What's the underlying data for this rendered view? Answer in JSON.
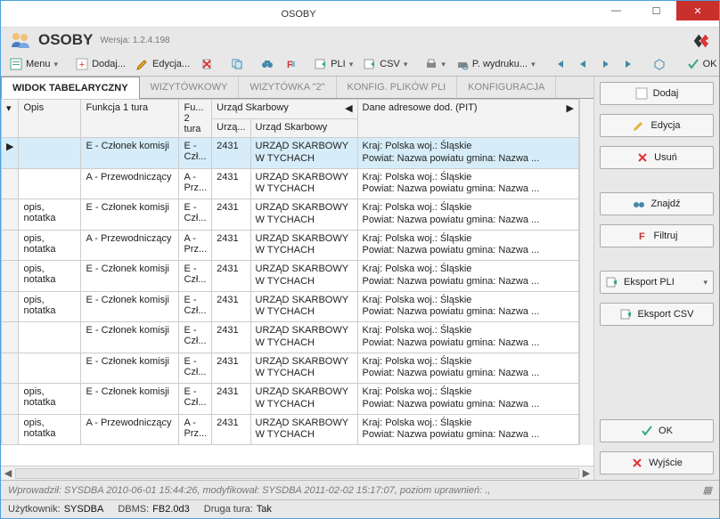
{
  "window": {
    "title": "OSOBY"
  },
  "header": {
    "app_title": "OSOBY",
    "version": "Wersja: 1.2.4.198"
  },
  "toolbar": {
    "menu": "Menu",
    "dodaj": "Dodaj...",
    "edycja": "Edycja...",
    "pli": "PLI",
    "csv": "CSV",
    "wydruk": "P. wydruku...",
    "ok": "OK"
  },
  "tabs": {
    "t1": "WIDOK TABELARYCZNY",
    "t2": "WIZYTÓWKOWY",
    "t3": "WIZYTÓWKA \"2\"",
    "t4": "KONFIG. PLIKÓW PLI",
    "t5": "KONFIGURACJA"
  },
  "grid": {
    "headers": {
      "opis": "Opis",
      "funkcja1": "Funkcja 1 tura",
      "fu2": "Fu... 2 tura",
      "urzad_group": "Urząd Skarbowy",
      "urzad_code": "Urzą...",
      "urzad_name": "Urząd Skarbowy",
      "dane": "Dane adresowe dod. (PIT)"
    },
    "rows": [
      {
        "sel": true,
        "opis": "",
        "funkcja1": "E - Członek komisji",
        "fu2": "E - Czł...",
        "ucode": "2431",
        "uname": "URZĄD SKARBOWY W TYCHACH",
        "dane": "Kraj: Polska woj.: Śląskie\nPowiat: Nazwa powiatu  gmina: Nazwa ..."
      },
      {
        "sel": false,
        "opis": "",
        "funkcja1": "A - Przewodniczący",
        "fu2": "A - Prz...",
        "ucode": "2431",
        "uname": "URZĄD SKARBOWY W TYCHACH",
        "dane": "Kraj: Polska woj.: Śląskie\nPowiat: Nazwa powiatu  gmina: Nazwa ..."
      },
      {
        "sel": false,
        "opis": "opis, notatka",
        "funkcja1": "E - Członek komisji",
        "fu2": "E - Czł...",
        "ucode": "2431",
        "uname": "URZĄD SKARBOWY W TYCHACH",
        "dane": "Kraj: Polska woj.: Śląskie\nPowiat: Nazwa powiatu  gmina: Nazwa ..."
      },
      {
        "sel": false,
        "opis": "opis, notatka",
        "funkcja1": "A - Przewodniczący",
        "fu2": "A - Prz...",
        "ucode": "2431",
        "uname": "URZĄD SKARBOWY W TYCHACH",
        "dane": "Kraj: Polska woj.: Śląskie\nPowiat: Nazwa powiatu  gmina: Nazwa ..."
      },
      {
        "sel": false,
        "opis": "opis, notatka",
        "funkcja1": "E - Członek komisji",
        "fu2": "E - Czł...",
        "ucode": "2431",
        "uname": "URZĄD SKARBOWY W TYCHACH",
        "dane": "Kraj: Polska woj.: Śląskie\nPowiat: Nazwa powiatu  gmina: Nazwa ..."
      },
      {
        "sel": false,
        "opis": "opis, notatka",
        "funkcja1": "E - Członek komisji",
        "fu2": "E - Czł...",
        "ucode": "2431",
        "uname": "URZĄD SKARBOWY W TYCHACH",
        "dane": "Kraj: Polska woj.: Śląskie\nPowiat: Nazwa powiatu  gmina: Nazwa ..."
      },
      {
        "sel": false,
        "opis": "",
        "funkcja1": "E - Członek komisji",
        "fu2": "E - Czł...",
        "ucode": "2431",
        "uname": "URZĄD SKARBOWY W TYCHACH",
        "dane": "Kraj: Polska woj.: Śląskie\nPowiat: Nazwa powiatu  gmina: Nazwa ..."
      },
      {
        "sel": false,
        "opis": "",
        "funkcja1": "E - Członek komisji",
        "fu2": "E - Czł...",
        "ucode": "2431",
        "uname": "URZĄD SKARBOWY W TYCHACH",
        "dane": "Kraj: Polska woj.: Śląskie\nPowiat: Nazwa powiatu  gmina: Nazwa ..."
      },
      {
        "sel": false,
        "opis": "opis, notatka",
        "funkcja1": "E - Członek komisji",
        "fu2": "E - Czł...",
        "ucode": "2431",
        "uname": "URZĄD SKARBOWY W TYCHACH",
        "dane": "Kraj: Polska woj.: Śląskie\nPowiat: Nazwa powiatu  gmina: Nazwa ..."
      },
      {
        "sel": false,
        "opis": "opis, notatka",
        "funkcja1": "A - Przewodniczący",
        "fu2": "A - Prz...",
        "ucode": "2431",
        "uname": "URZĄD SKARBOWY W TYCHACH",
        "dane": "Kraj: Polska woj.: Śląskie\nPowiat: Nazwa powiatu  gmina: Nazwa ..."
      }
    ]
  },
  "side": {
    "dodaj": "Dodaj",
    "edycja": "Edycja",
    "usun": "Usuń",
    "znajdz": "Znajdź",
    "filtruj": "Filtruj",
    "eksport_pli": "Eksport PLI",
    "eksport_csv": "Eksport CSV",
    "ok": "OK",
    "wyjscie": "Wyjście"
  },
  "status1": "Wprowadził: SYSDBA 2010-06-01 15:44:26,   modyfikował: SYSDBA   2011-02-02 15:17:07, poziom uprawnień: .,",
  "status2": {
    "uzytkownik_l": "Użytkownik:",
    "uzytkownik_v": "SYSDBA",
    "dbms_l": "DBMS:",
    "dbms_v": "FB2.0d3",
    "druga_l": "Druga tura:",
    "druga_v": "Tak"
  }
}
